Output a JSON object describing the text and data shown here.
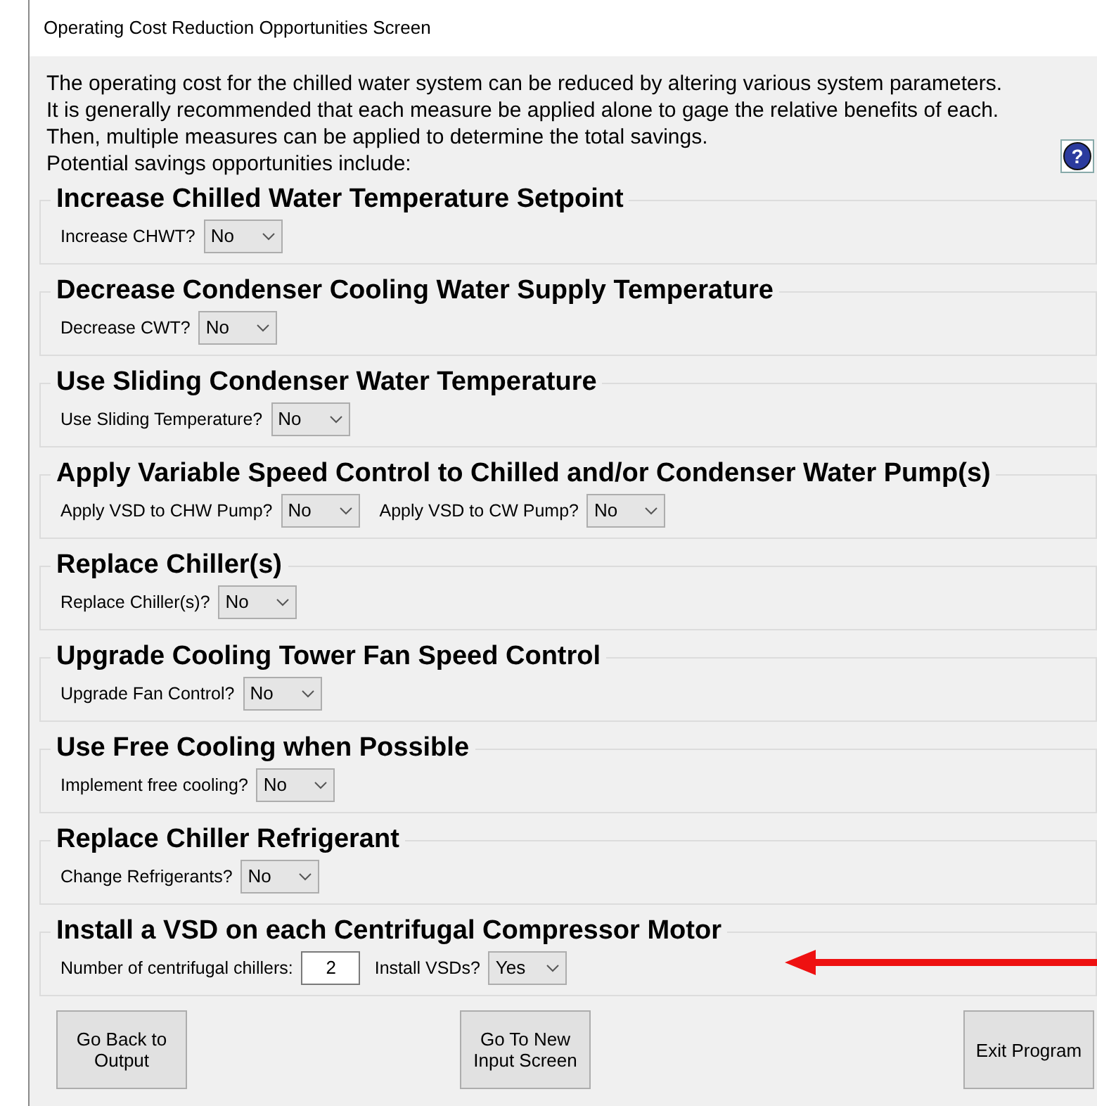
{
  "window": {
    "title": "Operating Cost Reduction Opportunities Screen"
  },
  "intro": [
    "The operating cost for the chilled water system can be reduced by altering various system parameters.",
    "It is generally recommended that each measure be applied alone to gage the relative benefits of each.",
    "Then, multiple measures can be applied to determine the total savings.",
    "Potential savings opportunities include:"
  ],
  "groups": [
    {
      "title": "Increase Chilled Water Temperature Setpoint",
      "fields": [
        {
          "kind": "select",
          "label": "Increase CHWT?",
          "value": "No"
        }
      ]
    },
    {
      "title": "Decrease Condenser Cooling Water Supply Temperature",
      "fields": [
        {
          "kind": "select",
          "label": "Decrease CWT?",
          "value": "No"
        }
      ]
    },
    {
      "title": "Use Sliding Condenser Water Temperature",
      "fields": [
        {
          "kind": "select",
          "label": "Use Sliding Temperature?",
          "value": "No"
        }
      ]
    },
    {
      "title": "Apply Variable Speed Control to Chilled and/or Condenser Water Pump(s)",
      "fields": [
        {
          "kind": "select",
          "label": "Apply VSD to CHW Pump?",
          "value": "No"
        },
        {
          "kind": "select",
          "label": "Apply VSD to CW Pump?",
          "value": "No"
        }
      ]
    },
    {
      "title": "Replace Chiller(s)",
      "fields": [
        {
          "kind": "select",
          "label": "Replace Chiller(s)?",
          "value": "No"
        }
      ]
    },
    {
      "title": "Upgrade Cooling Tower Fan Speed Control",
      "fields": [
        {
          "kind": "select",
          "label": "Upgrade Fan Control?",
          "value": "No"
        }
      ]
    },
    {
      "title": "Use Free Cooling when Possible",
      "fields": [
        {
          "kind": "select",
          "label": "Implement free cooling?",
          "value": "No"
        }
      ]
    },
    {
      "title": "Replace Chiller Refrigerant",
      "fields": [
        {
          "kind": "select",
          "label": "Change Refrigerants?",
          "value": "No"
        }
      ]
    },
    {
      "title": "Install a VSD on each Centrifugal Compressor Motor",
      "fields": [
        {
          "kind": "number",
          "label": "Number of centrifugal chillers:",
          "value": "2"
        },
        {
          "kind": "select",
          "label": "Install VSDs?",
          "value": "Yes"
        }
      ]
    }
  ],
  "help_button": {
    "label": "?"
  },
  "buttons": [
    {
      "label": "Go Back to Output"
    },
    {
      "label": "Go To New Input Screen"
    },
    {
      "label": "Exit Program"
    }
  ]
}
